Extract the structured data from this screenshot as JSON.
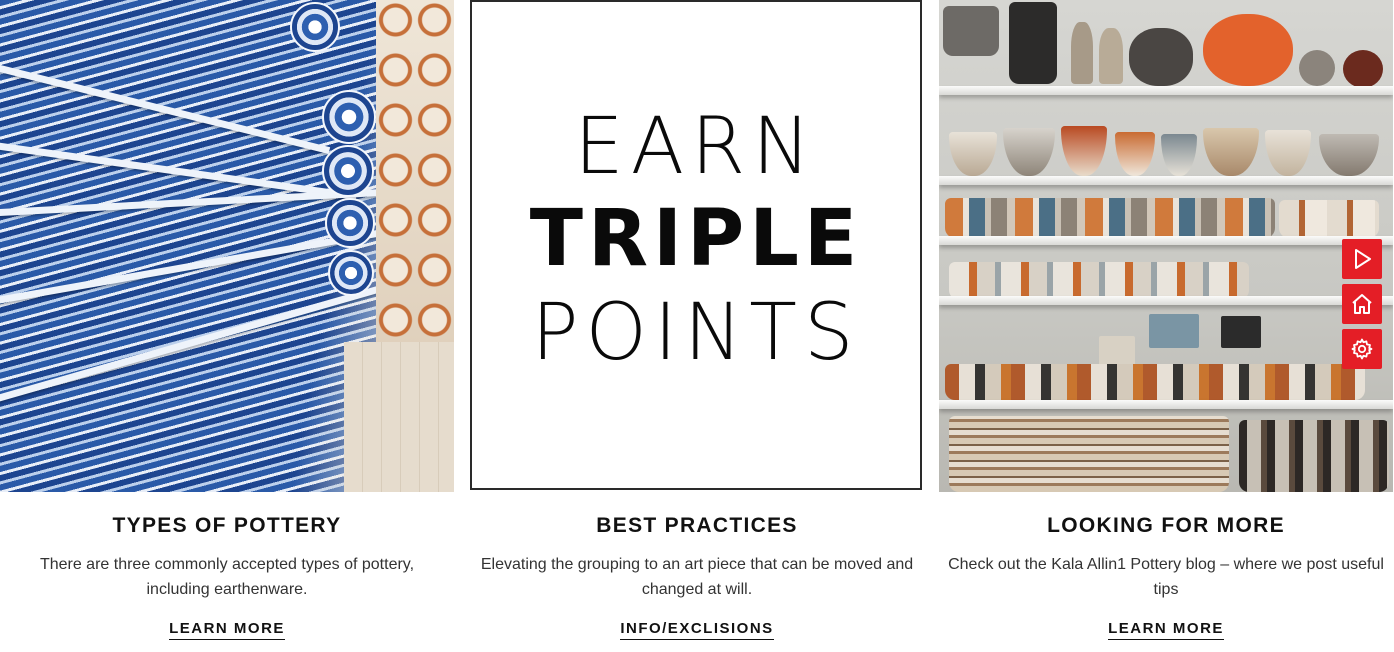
{
  "cards": [
    {
      "title": "TYPES OF POTTERY",
      "description": "There are three commonly accepted types of pottery, including earthenware.",
      "link_label": "LEARN MORE"
    },
    {
      "title": "BEST PRACTICES",
      "description": "Elevating the grouping to an art piece that can be moved and changed at will.",
      "link_label": "INFO/EXCLISIONS"
    },
    {
      "title": "LOOKING FOR MORE",
      "description": "Check out the Kala Allin1 Pottery blog – where we post useful tips",
      "link_label": "LEARN MORE"
    }
  ],
  "promo": {
    "line1": "EARN",
    "line2": "TRIPLE",
    "line3": "POINTS"
  },
  "side_toolbar": {
    "accent_color": "#e41e26",
    "items": [
      {
        "icon": "play-icon"
      },
      {
        "icon": "home-icon"
      },
      {
        "icon": "gear-icon"
      }
    ]
  }
}
